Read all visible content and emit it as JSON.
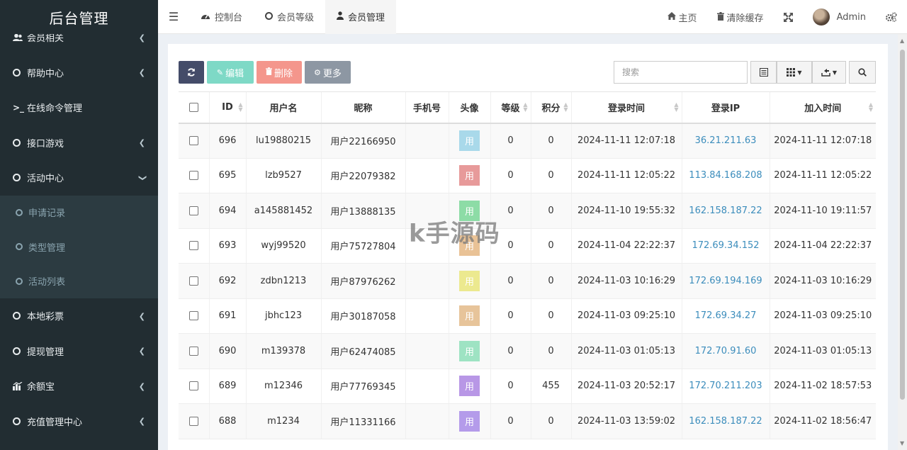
{
  "brand": {
    "title": "后台管理"
  },
  "sidebar": {
    "items": [
      {
        "label": "会员相关",
        "icon": "users-icon"
      },
      {
        "label": "帮助中心",
        "icon": "circle-icon"
      },
      {
        "label": "在线命令管理",
        "icon": "terminal-icon"
      },
      {
        "label": "接口游戏",
        "icon": "circle-icon"
      },
      {
        "label": "活动中心",
        "icon": "circle-icon"
      }
    ],
    "subitems": [
      {
        "label": "申请记录"
      },
      {
        "label": "类型管理"
      },
      {
        "label": "活动列表"
      }
    ],
    "items2": [
      {
        "label": "本地彩票",
        "icon": "circle-icon"
      },
      {
        "label": "提现管理",
        "icon": "circle-icon"
      },
      {
        "label": "余额宝",
        "icon": "chart-icon"
      },
      {
        "label": "充值管理中心",
        "icon": "circle-icon"
      }
    ]
  },
  "navbar": {
    "tabs": [
      {
        "label": "控制台",
        "icon": "dashboard-icon"
      },
      {
        "label": "会员等级",
        "icon": "circle-icon"
      },
      {
        "label": "会员管理",
        "icon": "user-icon"
      }
    ],
    "home": "主页",
    "clear_cache": "清除缓存",
    "user": "Admin"
  },
  "toolbar": {
    "edit": "编辑",
    "delete": "删除",
    "more": "更多",
    "search_placeholder": "搜索"
  },
  "table": {
    "headers": [
      "ID",
      "用户名",
      "昵称",
      "手机号",
      "头像",
      "等级",
      "积分",
      "登录时间",
      "登录IP",
      "加入时间"
    ],
    "rows": [
      {
        "id": "696",
        "username": "lu19880215",
        "nickname": "用户22166950",
        "phone": "",
        "avatar": "用",
        "avatar_color": "#a9d9ea",
        "level": "0",
        "points": "0",
        "login_time": "2024-11-11 12:07:18",
        "login_ip": "36.21.211.63",
        "join_time": "2024-11-11 12:07:18"
      },
      {
        "id": "695",
        "username": "lzb9527",
        "nickname": "用户22079382",
        "phone": "",
        "avatar": "用",
        "avatar_color": "#e79a9a",
        "level": "0",
        "points": "0",
        "login_time": "2024-11-11 12:05:22",
        "login_ip": "113.84.168.208",
        "join_time": "2024-11-11 12:05:22"
      },
      {
        "id": "694",
        "username": "a145881452",
        "nickname": "用户13888135",
        "phone": "",
        "avatar": "用",
        "avatar_color": "#8ddca6",
        "level": "0",
        "points": "0",
        "login_time": "2024-11-10 19:55:32",
        "login_ip": "162.158.187.22",
        "join_time": "2024-11-10 19:11:57"
      },
      {
        "id": "693",
        "username": "wyj99520",
        "nickname": "用户75727804",
        "phone": "",
        "avatar": "用",
        "avatar_color": "#e9c296",
        "level": "0",
        "points": "0",
        "login_time": "2024-11-04 22:22:37",
        "login_ip": "172.69.34.152",
        "join_time": "2024-11-04 22:22:37"
      },
      {
        "id": "692",
        "username": "zdbn1213",
        "nickname": "用户87976262",
        "phone": "",
        "avatar": "用",
        "avatar_color": "#ece98f",
        "level": "0",
        "points": "0",
        "login_time": "2024-11-03 10:16:29",
        "login_ip": "172.69.194.169",
        "join_time": "2024-11-03 10:16:29"
      },
      {
        "id": "691",
        "username": "jbhc123",
        "nickname": "用户30187058",
        "phone": "",
        "avatar": "用",
        "avatar_color": "#e7c49a",
        "level": "0",
        "points": "0",
        "login_time": "2024-11-03 09:25:10",
        "login_ip": "172.69.34.27",
        "join_time": "2024-11-03 09:25:10"
      },
      {
        "id": "690",
        "username": "m139378",
        "nickname": "用户62474085",
        "phone": "",
        "avatar": "用",
        "avatar_color": "#9ee3c3",
        "level": "0",
        "points": "0",
        "login_time": "2024-11-03 01:05:13",
        "login_ip": "172.70.91.60",
        "join_time": "2024-11-03 01:05:13"
      },
      {
        "id": "689",
        "username": "m12346",
        "nickname": "用户77769345",
        "phone": "",
        "avatar": "用",
        "avatar_color": "#b897e6",
        "level": "0",
        "points": "455",
        "login_time": "2024-11-03 20:52:17",
        "login_ip": "172.70.211.203",
        "join_time": "2024-11-02 18:57:53"
      },
      {
        "id": "688",
        "username": "m1234",
        "nickname": "用户11331166",
        "phone": "",
        "avatar": "用",
        "avatar_color": "#b49bea",
        "level": "0",
        "points": "0",
        "login_time": "2024-11-03 13:59:02",
        "login_ip": "162.158.187.22",
        "join_time": "2024-11-02 18:56:47"
      }
    ]
  },
  "watermark": "k手源码"
}
